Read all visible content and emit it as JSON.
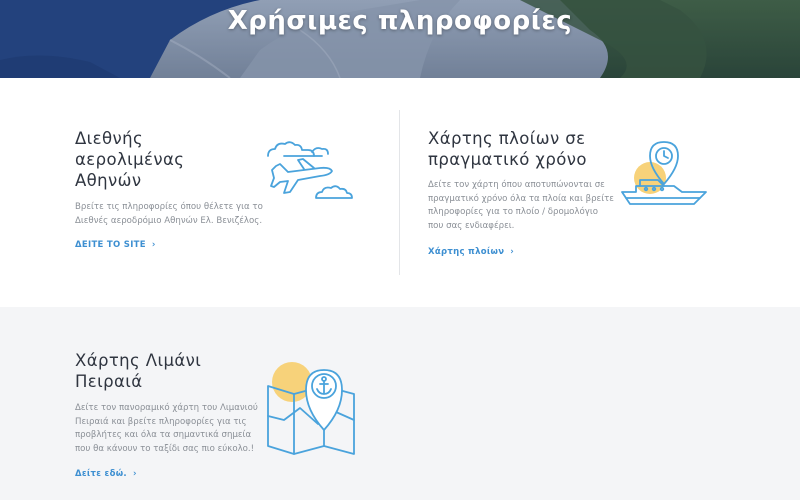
{
  "header": {
    "title": "Χρήσιμες πληροφορίες"
  },
  "cards": [
    {
      "title_lines": [
        "Διεθνής",
        "αερολιμένας",
        "Αθηνών"
      ],
      "description_lines": [
        "Βρείτε τις πληροφορίες όπου θέλετε για το",
        "Διεθνές αεροδρόμιο Αθηνών Ελ. Βενιζέλος."
      ],
      "link_label": "ΔΕΙΤΕ ΤΟ SITE",
      "icon": "airplane-clouds-icon"
    },
    {
      "title_lines": [
        "Χάρτης πλοίων σε",
        "πραγματικό χρόνο"
      ],
      "description_lines": [
        "Δείτε τον χάρτη όπου αποτυπώνονται σε",
        "πραγματικό χρόνο όλα τα πλοία και βρείτε",
        "πληροφορίες για το πλοίο / δρομολόγιο",
        "που σας ενδιαφέρει."
      ],
      "link_label": "Χάρτης πλοίων",
      "icon": "ship-location-clock-icon"
    },
    {
      "title_lines": [
        "Χάρτης Λιμάνι",
        "Πειραιά"
      ],
      "description_lines": [
        "Δείτε τον πανοραμικό χάρτη του Λιμανιού",
        "Πειραιά και βρείτε πληροφορίες για τις",
        "προβλήτες και όλα τα σημαντικά σημεία",
        "που θα κάνουν το ταξίδι σας πιο εύκολο.!"
      ],
      "link_label": "Δείτε εδώ.",
      "icon": "port-map-anchor-icon"
    }
  ],
  "colors": {
    "accent": "#3d8fd1",
    "icon_stroke": "#4aa3dc",
    "icon_sun": "#f7d27a",
    "hero_bg": "#2b4c8c",
    "section_gray": "#f4f5f7"
  }
}
